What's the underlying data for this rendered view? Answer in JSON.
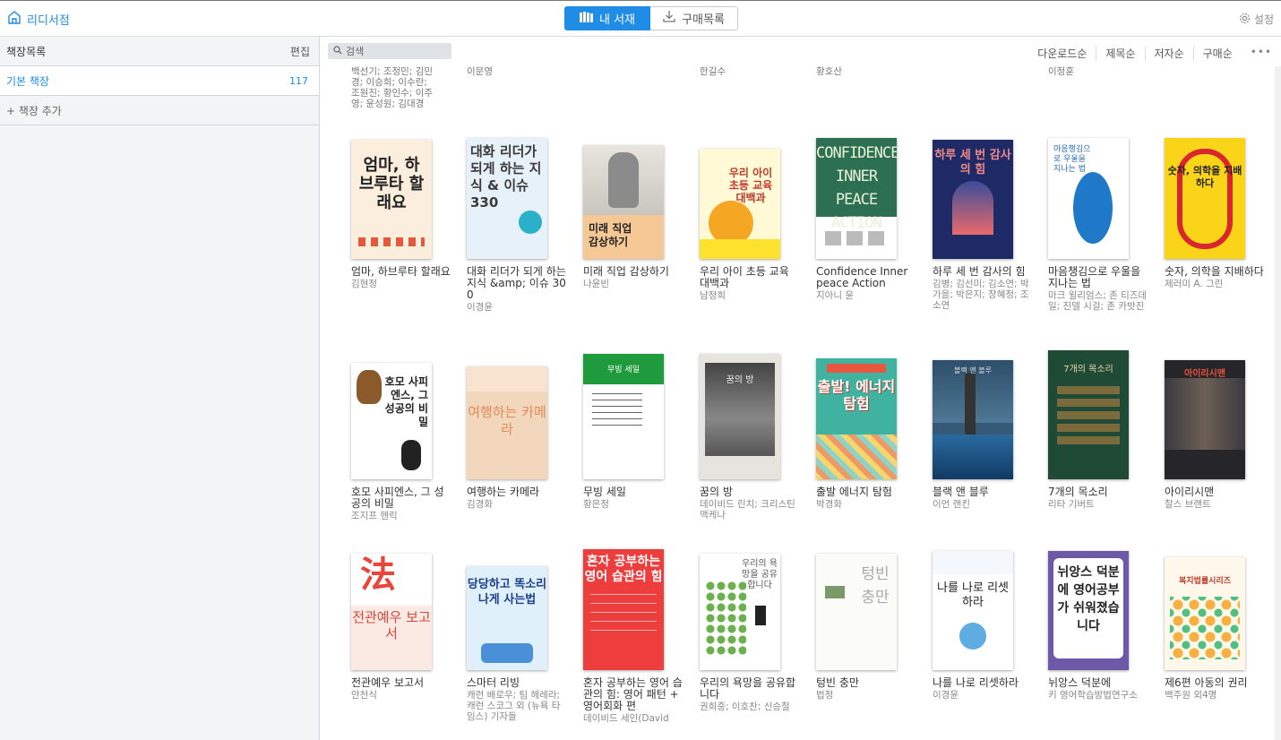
{
  "app": {
    "brand": "리디서점"
  },
  "tabs": {
    "mine": "내 서재",
    "purchases": "구매목록"
  },
  "settings_label": "설정",
  "sidebar": {
    "title": "책장목록",
    "edit": "편집",
    "shelf": {
      "name": "기본 책장",
      "count": "117"
    },
    "add": "+ 책장 추가"
  },
  "search": {
    "placeholder": "검색"
  },
  "sort": {
    "download": "다운로드순",
    "title": "제목순",
    "author": "저자순",
    "purchase": "구매순",
    "more": "•••"
  },
  "prev_row": [
    "백선기; 조정민; 김민경; 이승희; 이수란; 조원진; 황인수; 이주영; 윤성원; 김대경",
    "이문영",
    "한길수",
    "황호산",
    "이정훈"
  ],
  "books_row1": [
    {
      "title": "엄마, 하브루타 할래요",
      "author": "김현정",
      "cover_text": "엄마, 하브루타 할래요"
    },
    {
      "title": "대화 리더가 되게 하는 지식 &amp; 이슈 300",
      "author": "이경윤",
      "cover_text": "대화 리더가 되게 하는 지식 & 이슈 330"
    },
    {
      "title": "미래 직업 감상하기",
      "author": "나윤빈",
      "cover_text": "미래 직업 감상하기"
    },
    {
      "title": "우리 아이 초등 교육 대백과",
      "author": "남정희",
      "cover_text": "우리 아이 초등 교육 대백과"
    },
    {
      "title": "Confidence Inner peace Action",
      "author": "지아니 윤",
      "cover_text": "CONFIDENCE INNER PEACE ACTION"
    },
    {
      "title": "하루 세 번 감사의 힘",
      "author": "김병; 김선미; 김소연; 박가을; 박은지; 장혜정; 조소연",
      "cover_text": "하루 세 번 감사의 힘"
    },
    {
      "title": "마음챙김으로 우울을 지나는 법",
      "author": "마크 윌리엄스; 존 티즈데일; 진델 시걸; 존 카밧진",
      "cover_text": "마음챙김으로 우울을 지나는 법"
    },
    {
      "title": "숫자, 의학을 지배하다",
      "author": "제러미 A. 그린",
      "cover_text": "숫자, 의학을 지배하다"
    }
  ],
  "books_row2": [
    {
      "title": "호모 사피엔스, 그 성공의 비밀",
      "author": "조지프 헨릭",
      "cover_text": "호모 사피엔스, 그 성공의 비밀"
    },
    {
      "title": "여행하는 카메라",
      "author": "김경화",
      "cover_text": "여행하는 카메라"
    },
    {
      "title": "무빙 세일",
      "author": "황은정",
      "cover_text": "무빙 세일"
    },
    {
      "title": "꿈의 방",
      "author": "데이비드 린치; 크리스틴 맥케나",
      "cover_text": "꿈의 방"
    },
    {
      "title": "출발 에너지 탐험",
      "author": "박경화",
      "cover_text": "출발! 에너지 탐험"
    },
    {
      "title": "블랙 앤 블루",
      "author": "이언 랜킨",
      "cover_text": "블랙 앤 블루"
    },
    {
      "title": "7개의 목소리",
      "author": "리타 기버트",
      "cover_text": "7개의 목소리"
    },
    {
      "title": "아이리시맨",
      "author": "찰스 브랜트",
      "cover_text": "아이리시맨"
    }
  ],
  "books_row3": [
    {
      "title": "전관예우 보고서",
      "author": "안천식",
      "cover_text": "전관예우 보고서"
    },
    {
      "title": "스마터 리빙",
      "author": "캐런 배로우; 팀 헤레라; 캐런 스코그 외 (뉴욕 타임스) 기자들",
      "cover_text": "당당하고 똑소리나게 사는법"
    },
    {
      "title": "혼자 공부하는 영어 습관의 힘: 영어 패턴 + 영어회화 편",
      "author": "데이비드 세인(David",
      "cover_text": "혼자 공부하는 영어 습관의 힘"
    },
    {
      "title": "우리의 욕망을 공유합니다",
      "author": "권희중; 이호찬; 신승철",
      "cover_text": "우리의 욕망을 공유합니다"
    },
    {
      "title": "텅빈 충만",
      "author": "법정",
      "cover_text": "텅빈 충만"
    },
    {
      "title": "나를 나로 리셋하라",
      "author": "이경윤",
      "cover_text": "나를 나로 리셋하라"
    },
    {
      "title": "뉘앙스 덕분에",
      "author": "키 영어학습방법연구소",
      "cover_text": "뉘앙스 덕분에 영어공부가 쉬워졌습니다"
    },
    {
      "title": "제6편 아동의 권리",
      "author": "백주원 외4명",
      "cover_text": "복지법률시리즈"
    }
  ]
}
